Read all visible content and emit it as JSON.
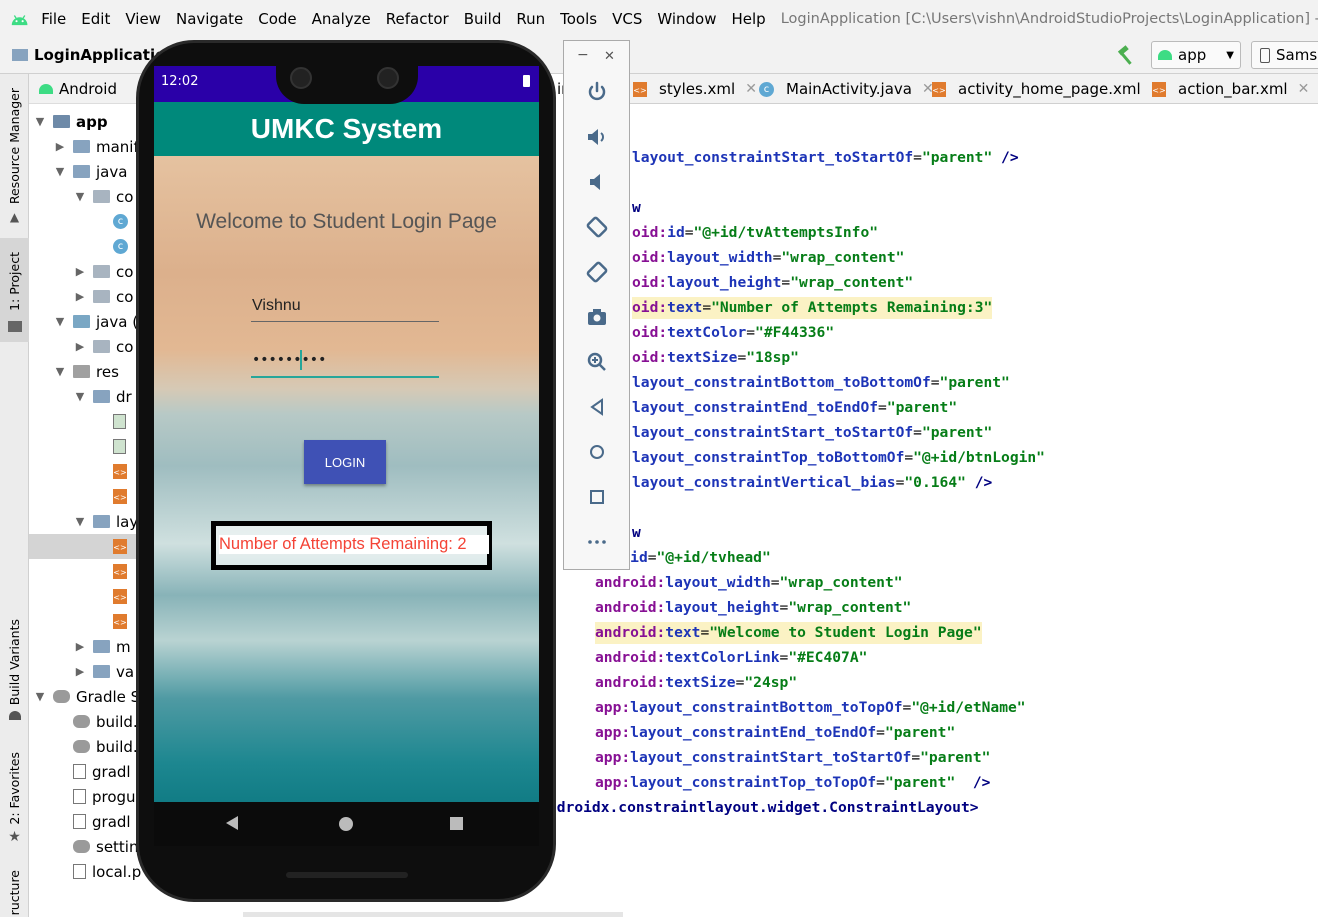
{
  "menu": {
    "items": [
      "File",
      "Edit",
      "View",
      "Navigate",
      "Code",
      "Analyze",
      "Refactor",
      "Build",
      "Run",
      "Tools",
      "VCS",
      "Window",
      "Help"
    ],
    "window_title": "LoginApplication [C:\\Users\\vishn\\AndroidStudioProjects\\LoginApplication] - ...\\app\\src"
  },
  "toolbar": {
    "project_name": "LoginApplication",
    "run_config": "app",
    "device": "Sams"
  },
  "left_strip": {
    "resource_manager": "Resource Manager",
    "project": "1: Project",
    "build_variants": "Build Variants",
    "favorites": "2: Favorites",
    "structure": "ructure"
  },
  "project_panel": {
    "view_mode": "Android",
    "tree": [
      {
        "label": "app",
        "icon": "module-folder"
      },
      {
        "label": "manif",
        "icon": "folder"
      },
      {
        "label": "java",
        "icon": "folder"
      },
      {
        "label": "co",
        "icon": "package"
      },
      {
        "label": "",
        "icon": "class"
      },
      {
        "label": "",
        "icon": "class"
      },
      {
        "label": "co",
        "icon": "package"
      },
      {
        "label": "co",
        "icon": "package"
      },
      {
        "label": "java (",
        "icon": "generated-folder"
      },
      {
        "label": "co",
        "icon": "package"
      },
      {
        "label": "res",
        "icon": "res-folder"
      },
      {
        "label": "dr",
        "icon": "folder"
      },
      {
        "label": "",
        "icon": "image"
      },
      {
        "label": "",
        "icon": "image"
      },
      {
        "label": "",
        "icon": "xml"
      },
      {
        "label": "",
        "icon": "xml"
      },
      {
        "label": "lay",
        "icon": "folder"
      },
      {
        "label": "",
        "icon": "xml"
      },
      {
        "label": "",
        "icon": "xml"
      },
      {
        "label": "",
        "icon": "xml"
      },
      {
        "label": "",
        "icon": "xml"
      },
      {
        "label": "m",
        "icon": "folder"
      },
      {
        "label": "va",
        "icon": "folder"
      },
      {
        "label": "Gradle Sc",
        "icon": "gradle"
      },
      {
        "label": "build.",
        "icon": "gradle"
      },
      {
        "label": "build.",
        "icon": "gradle"
      },
      {
        "label": "gradl",
        "icon": "file"
      },
      {
        "label": "progu",
        "icon": "file"
      },
      {
        "label": "gradl",
        "icon": "file"
      },
      {
        "label": "settin",
        "icon": "gradle"
      },
      {
        "label": "local.p",
        "icon": "file"
      }
    ]
  },
  "editor_tabs": [
    {
      "label": "in"
    },
    {
      "label": "styles.xml"
    },
    {
      "label": "MainActivity.java"
    },
    {
      "label": "activity_home_page.xml"
    },
    {
      "label": "action_bar.xml"
    }
  ],
  "code_lines": [
    [
      {
        "t": "layout_constraintStart_toStartOf",
        "c": "at"
      },
      {
        "t": "=",
        "c": "pl"
      },
      {
        "t": "\"parent\"",
        "c": "sv"
      },
      {
        "t": " />",
        "c": "tg"
      }
    ],
    [],
    [
      {
        "t": "w",
        "c": "tg"
      }
    ],
    [
      {
        "t": "oid:",
        "c": "ns"
      },
      {
        "t": "id",
        "c": "at"
      },
      {
        "t": "=",
        "c": "pl"
      },
      {
        "t": "\"@+id/tvAttemptsInfo\"",
        "c": "sv"
      }
    ],
    [
      {
        "t": "oid:",
        "c": "ns"
      },
      {
        "t": "layout_width",
        "c": "at"
      },
      {
        "t": "=",
        "c": "pl"
      },
      {
        "t": "\"wrap_content\"",
        "c": "sv"
      }
    ],
    [
      {
        "t": "oid:",
        "c": "ns"
      },
      {
        "t": "layout_height",
        "c": "at"
      },
      {
        "t": "=",
        "c": "pl"
      },
      {
        "t": "\"wrap_content\"",
        "c": "sv"
      }
    ],
    [
      {
        "t": "oid:",
        "c": "ns"
      },
      {
        "t": "text",
        "c": "at"
      },
      {
        "t": "=",
        "c": "pl"
      },
      {
        "t": "\"Number of Attempts Remaining:3\"",
        "c": "sv"
      }
    ],
    [
      {
        "t": "oid:",
        "c": "ns"
      },
      {
        "t": "textColor",
        "c": "at"
      },
      {
        "t": "=",
        "c": "pl"
      },
      {
        "t": "\"#F44336\"",
        "c": "sv"
      }
    ],
    [
      {
        "t": "oid:",
        "c": "ns"
      },
      {
        "t": "textSize",
        "c": "at"
      },
      {
        "t": "=",
        "c": "pl"
      },
      {
        "t": "\"18sp\"",
        "c": "sv"
      }
    ],
    [
      {
        "t": "layout_constraintBottom_toBottomOf",
        "c": "at"
      },
      {
        "t": "=",
        "c": "pl"
      },
      {
        "t": "\"parent\"",
        "c": "sv"
      }
    ],
    [
      {
        "t": "layout_constraintEnd_toEndOf",
        "c": "at"
      },
      {
        "t": "=",
        "c": "pl"
      },
      {
        "t": "\"parent\"",
        "c": "sv"
      }
    ],
    [
      {
        "t": "layout_constraintStart_toStartOf",
        "c": "at"
      },
      {
        "t": "=",
        "c": "pl"
      },
      {
        "t": "\"parent\"",
        "c": "sv"
      }
    ],
    [
      {
        "t": "layout_constraintTop_toBottomOf",
        "c": "at"
      },
      {
        "t": "=",
        "c": "pl"
      },
      {
        "t": "\"@+id/btnLogin\"",
        "c": "sv"
      }
    ],
    [
      {
        "t": "layout_constraintVertical_bias",
        "c": "at"
      },
      {
        "t": "=",
        "c": "pl"
      },
      {
        "t": "\"0.164\"",
        "c": "sv"
      },
      {
        "t": " />",
        "c": "tg"
      }
    ],
    [],
    [
      {
        "t": "w",
        "c": "tg"
      }
    ],
    [
      {
        "t": "oid:",
        "c": "ns"
      },
      {
        "t": "id",
        "c": "at"
      },
      {
        "t": "=",
        "c": "pl"
      },
      {
        "t": "\"@+id/tvhead\"",
        "c": "sv"
      }
    ],
    [
      {
        "t": "android:",
        "c": "ns"
      },
      {
        "t": "layout_width",
        "c": "at"
      },
      {
        "t": "=",
        "c": "pl"
      },
      {
        "t": "\"wrap_content\"",
        "c": "sv"
      }
    ],
    [
      {
        "t": "android:",
        "c": "ns"
      },
      {
        "t": "layout_height",
        "c": "at"
      },
      {
        "t": "=",
        "c": "pl"
      },
      {
        "t": "\"wrap_content\"",
        "c": "sv"
      }
    ],
    [
      {
        "t": "android:",
        "c": "ns"
      },
      {
        "t": "text",
        "c": "at"
      },
      {
        "t": "=",
        "c": "pl"
      },
      {
        "t": "\"Welcome to Student Login Page\"",
        "c": "sv"
      }
    ],
    [
      {
        "t": "android:",
        "c": "ns"
      },
      {
        "t": "textColorLink",
        "c": "at"
      },
      {
        "t": "=",
        "c": "pl"
      },
      {
        "t": "\"#EC407A\"",
        "c": "sv"
      }
    ],
    [
      {
        "t": "android:",
        "c": "ns"
      },
      {
        "t": "textSize",
        "c": "at"
      },
      {
        "t": "=",
        "c": "pl"
      },
      {
        "t": "\"24sp\"",
        "c": "sv"
      }
    ],
    [
      {
        "t": "app:",
        "c": "ns"
      },
      {
        "t": "layout_constraintBottom_toTopOf",
        "c": "at"
      },
      {
        "t": "=",
        "c": "pl"
      },
      {
        "t": "\"@+id/etName\"",
        "c": "sv"
      }
    ],
    [
      {
        "t": "app:",
        "c": "ns"
      },
      {
        "t": "layout_constraintEnd_toEndOf",
        "c": "at"
      },
      {
        "t": "=",
        "c": "pl"
      },
      {
        "t": "\"parent\"",
        "c": "sv"
      }
    ],
    [
      {
        "t": "app:",
        "c": "ns"
      },
      {
        "t": "layout_constraintStart_toStartOf",
        "c": "at"
      },
      {
        "t": "=",
        "c": "pl"
      },
      {
        "t": "\"parent\"",
        "c": "sv"
      }
    ],
    [
      {
        "t": "app:",
        "c": "ns"
      },
      {
        "t": "layout_constraintTop_toTopOf",
        "c": "at"
      },
      {
        "t": "=",
        "c": "pl"
      },
      {
        "t": "\"parent\"",
        "c": "sv"
      },
      {
        "t": "  />",
        "c": "tg"
      }
    ],
    [
      {
        "t": "ndroidx.constraintlayout.widget.ConstraintLayout>",
        "c": "tg"
      }
    ]
  ],
  "phone": {
    "time": "12:02",
    "app_title": "UMKC System",
    "welcome": "Welcome to Student Login Page",
    "username_value": "Vishnu",
    "password_value": "•••••••••",
    "login_label": "LOGIN",
    "attempts_text": "Number of Attempts Remaining: 2"
  },
  "colors": {
    "status_bar": "#2a00a8",
    "app_bar": "#00897b",
    "login_button": "#3f51b5",
    "attempts_text": "#f44336",
    "field_focus_line": "#26a69a"
  },
  "emulator_controls": [
    "minimize-icon",
    "close-icon",
    "power-icon",
    "volume-up-icon",
    "volume-down-icon",
    "rotate-left-icon",
    "rotate-right-icon",
    "camera-icon",
    "zoom-icon",
    "back-icon",
    "home-icon",
    "overview-icon",
    "more-icon"
  ]
}
